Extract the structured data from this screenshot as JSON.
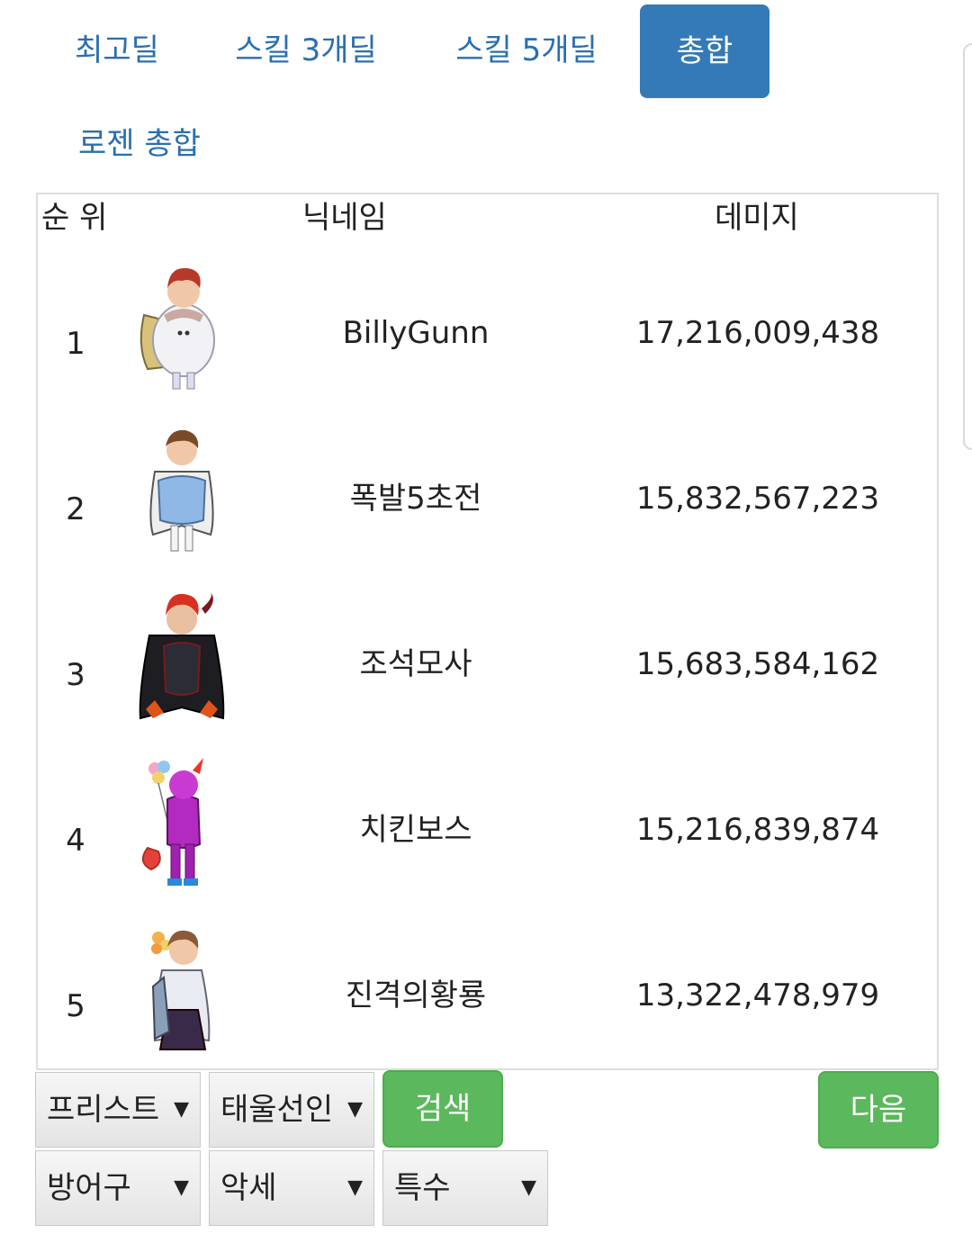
{
  "tabs": [
    "최고딜",
    "스킬 3개딜",
    "스킬 5개딜",
    "총합",
    "로젠 총합"
  ],
  "active_tab": "총합",
  "colors": {
    "accent": "#337ab7",
    "link": "#2a6fb0",
    "success": "#5cb85c"
  },
  "table": {
    "headers": {
      "rank": "순 위",
      "nickname": "닉네임",
      "damage": "데미지"
    },
    "rows": [
      {
        "rank": "1",
        "nickname": "BillyGunn",
        "damage": "17,216,009,438",
        "avatar": "snowman-costume-character"
      },
      {
        "rank": "2",
        "nickname": "폭발5초전",
        "damage": "15,832,567,223",
        "avatar": "blue-caped-character"
      },
      {
        "rank": "3",
        "nickname": "조석모사",
        "damage": "15,683,584,162",
        "avatar": "dark-armored-character"
      },
      {
        "rank": "4",
        "nickname": "치킨보스",
        "damage": "15,216,839,874",
        "avatar": "purple-balloon-character"
      },
      {
        "rank": "5",
        "nickname": "진격의황룡",
        "damage": "13,322,478,979",
        "avatar": "white-coat-character"
      }
    ]
  },
  "filters": {
    "class": "프리스트",
    "build": "태울선인",
    "armor": "방어구",
    "accessory": "악세",
    "special": "특수",
    "arrow": "▼"
  },
  "buttons": {
    "search": "검색",
    "next": "다음"
  }
}
